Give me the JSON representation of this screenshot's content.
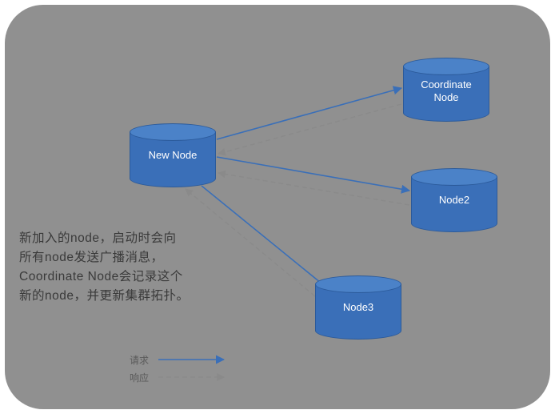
{
  "nodes": {
    "new": {
      "label": "New Node"
    },
    "coordinate": {
      "label_l1": "Coordinate",
      "label_l2": "Node"
    },
    "node2": {
      "label": "Node2"
    },
    "node3": {
      "label": "Node3"
    }
  },
  "description": {
    "l1": "新加入的node，启动时会向",
    "l2": "所有node发送广播消息，",
    "l3": "Coordinate Node会记录这个",
    "l4": "新的node，并更新集群拓扑。"
  },
  "legend": {
    "request": "请求",
    "response": "响应"
  },
  "colors": {
    "arrow_request": "#3a6fb8",
    "arrow_response": "#8a8a8a",
    "node_fill": "#3a6fb8",
    "node_top": "#4b82c8",
    "panel_bg": "#909090"
  },
  "chart_data": {
    "type": "diagram",
    "title": "",
    "nodes": [
      {
        "id": "new",
        "label": "New Node",
        "kind": "datastore"
      },
      {
        "id": "coordinate",
        "label": "Coordinate Node",
        "kind": "datastore"
      },
      {
        "id": "node2",
        "label": "Node2",
        "kind": "datastore"
      },
      {
        "id": "node3",
        "label": "Node3",
        "kind": "datastore"
      }
    ],
    "edges": [
      {
        "from": "new",
        "to": "coordinate",
        "type": "request"
      },
      {
        "from": "coordinate",
        "to": "new",
        "type": "response"
      },
      {
        "from": "new",
        "to": "node2",
        "type": "request"
      },
      {
        "from": "node2",
        "to": "new",
        "type": "response"
      },
      {
        "from": "new",
        "to": "node3",
        "type": "request"
      },
      {
        "from": "node3",
        "to": "new",
        "type": "response"
      }
    ],
    "legend": {
      "request": "请求",
      "response": "响应"
    },
    "annotation": "新加入的node，启动时会向所有node发送广播消息，Coordinate Node会记录这个新的node，并更新集群拓扑。"
  }
}
